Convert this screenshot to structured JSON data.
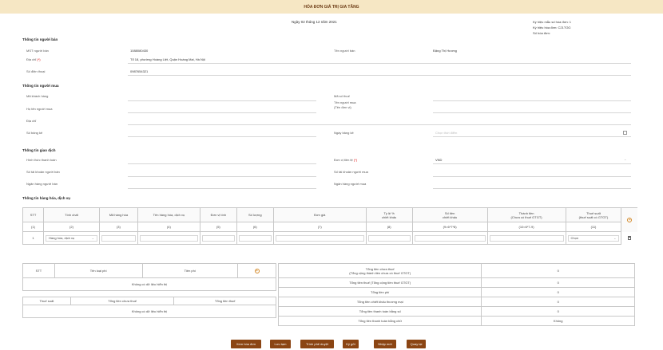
{
  "title": "HÓA ĐƠN GIÁ TRỊ GIA TĂNG",
  "date_text": "Ngày 02 tháng 12 năm 2021",
  "header_right": {
    "form_no": "Ký hiệu mẫu số hóa đơn: 1",
    "symbol": "Ký hiệu hóa đơn: C21TGG",
    "invoice_no": "Số hóa đơn:"
  },
  "seller": {
    "section": "Thông tin người bán",
    "tax_label": "MST người bán",
    "tax_value": "1088080430",
    "name_label": "Tên người bán",
    "name_value": "Đặng Thị Hương",
    "address_label": "Địa chỉ",
    "address_value": "Tổ 18, phường Hoàng Liệt, Quận Hoàng Mai, Hà Nội",
    "phone_label": "Số điện thoại",
    "phone_value": "0987654321"
  },
  "buyer": {
    "section": "Thông tin người mua",
    "customer_code": "Mã khách hàng",
    "tax_code": "Mã số thuế",
    "buyer_name": "Họ tên người mua",
    "unit_name": "Tên người mua",
    "unit_name2": "(Tên đơn vị)",
    "address": "Địa chỉ",
    "list_no": "Số bảng kê",
    "list_date": "Ngày bảng kê",
    "date_placeholder": "Chọn thời điểm"
  },
  "transaction": {
    "section": "Thông tin giao dịch",
    "payment": "Hình thức thanh toán",
    "currency": "Đơn vị tiền tệ",
    "currency_value": "VND",
    "seller_account": "Số tài khoản người bán",
    "buyer_account": "Số tài khoản người mua",
    "seller_bank": "Ngân hàng người bán",
    "buyer_bank": "Ngân hàng người mua"
  },
  "goods": {
    "section": "Thông tin hàng hóa, dịch vụ",
    "headers": [
      "STT",
      "Tính chất",
      "Mã hàng hóa",
      "Tên hàng hóa, dịch vụ",
      "Đơn vị tính",
      "Số lượng",
      "Đơn giá",
      "Tỷ lệ %",
      "chiết khấu",
      "Số tiền",
      "chiết khấu",
      "Thành tiền",
      "(Chưa có thuế GTGT)",
      "Thuế suất",
      "(thuế suất có GTGT)"
    ],
    "codes": [
      "(1)",
      "(2)",
      "(3)",
      "(4)",
      "(5)",
      "(6)",
      "(7)",
      "(8)",
      "(9=6*7*8)",
      "(10=6*7-9)",
      "(11)"
    ],
    "row_stt": "1",
    "row_type": "Hàng hóa, dịch vụ",
    "row_tax": "Chọn"
  },
  "fees": {
    "headers": [
      "STT",
      "Tên loại phí",
      "Tiền phí"
    ],
    "empty": "Không có dữ liệu hiển thị",
    "tax_headers": [
      "Thuế suất",
      "Tổng tiền chưa thuế",
      "Tổng tiền thuế"
    ],
    "tax_empty": "Không có dữ liệu hiển thị"
  },
  "totals": [
    {
      "label": "Tổng tiền chưa thuế",
      "label2": "(Tổng cộng thành tiền chưa có thuế GTGT)",
      "value": "0"
    },
    {
      "label": "Tổng tiền thuế (Tổng cộng tiền thuế GTGT)",
      "label2": "",
      "value": "0"
    },
    {
      "label": "Tổng tiền phí",
      "label2": "",
      "value": "0"
    },
    {
      "label": "Tổng tiền chiết khấu thương mại",
      "label2": "",
      "value": "0"
    },
    {
      "label": "Tổng tiền thanh toán bằng số",
      "label2": "",
      "value": "0"
    },
    {
      "label": "Tổng tiền thanh toán bằng chữ",
      "label2": "",
      "value": "Không"
    }
  ],
  "buttons": {
    "view": "Xem hóa đơn",
    "save": "Lưu tạm",
    "submit": "Trình phê duyệt",
    "sign": "Ký gửi",
    "new": "Nhập mới",
    "back": "Quay lại"
  }
}
